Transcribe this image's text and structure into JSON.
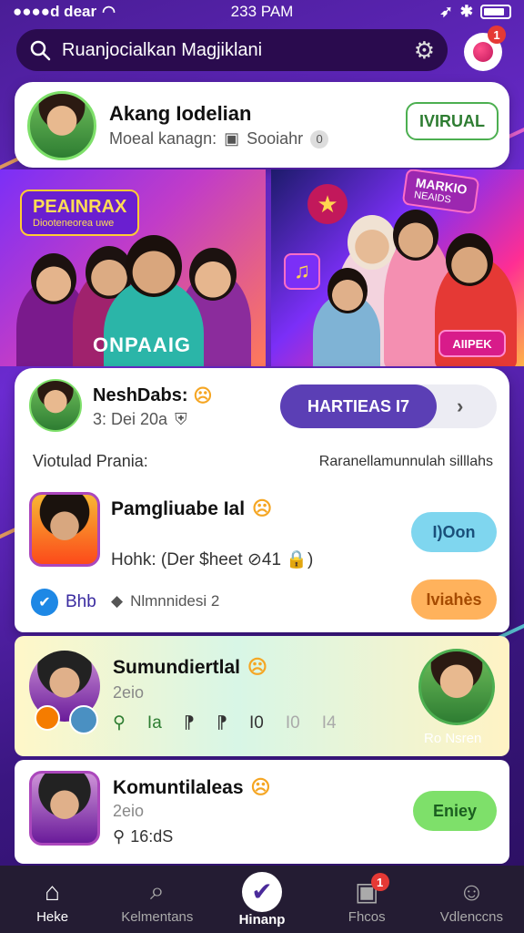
{
  "status": {
    "carrier": "●●●●d dear",
    "time": "233 PAM"
  },
  "search": {
    "text": "Ruanjocialkan Magjiklani",
    "badge": "1"
  },
  "profile_card": {
    "name": "Akang Iodelian",
    "subtitle": "Moeal kanagn:",
    "meta": "Sooiahr",
    "meta_count": "0",
    "button": "IVIRUAL"
  },
  "banners": {
    "left": {
      "tag_title": "PEAINRAX",
      "tag_sub": "Diooteneorea uwe",
      "caption": "ONPAAIG"
    },
    "right": {
      "tag_title": "MARKIO",
      "tag_sub": "NEAIDS",
      "cta": "AIIPEK"
    }
  },
  "feed_header": {
    "name": "NeshDabs:",
    "date": "3: Dei 20a",
    "button": "HARTIEAS I7",
    "label_left": "Viotulad Prania:",
    "label_right": "Raranellamunnulah silllahs"
  },
  "posts": [
    {
      "title": "Pamgliuabe Ial",
      "meta": "Hohk: (Der $heet ⊘41 🔒)",
      "button": "I)Oon",
      "tag1": "Bhb",
      "tag2": "Nlmnnidesi 2",
      "button2": "Iviahès"
    },
    {
      "title": "Sumundiertlal",
      "subtitle": "2eio",
      "stats": [
        "Ia",
        "⁋",
        "⁋",
        "I0",
        "I0",
        "I4"
      ],
      "right_label": "Ro Nsren"
    },
    {
      "title": "Komuntilaleas",
      "subtitle": "2eio",
      "meta": "16:dS",
      "button": "Eniey"
    }
  ],
  "nav": [
    {
      "label": "Heke",
      "icon": "home-icon"
    },
    {
      "label": "Kelmentans",
      "icon": "search-icon"
    },
    {
      "label": "Hinanp",
      "icon": "check-icon"
    },
    {
      "label": "Fhcos",
      "icon": "photo-icon",
      "badge": "1"
    },
    {
      "label": "Vdlenccns",
      "icon": "user-icon"
    }
  ],
  "colors": {
    "accent": "#5b3fb5",
    "primary_bg": "#4a1d96",
    "mint": "#7fd6ef",
    "orange": "#ffb25c",
    "green": "#7ee06a"
  }
}
